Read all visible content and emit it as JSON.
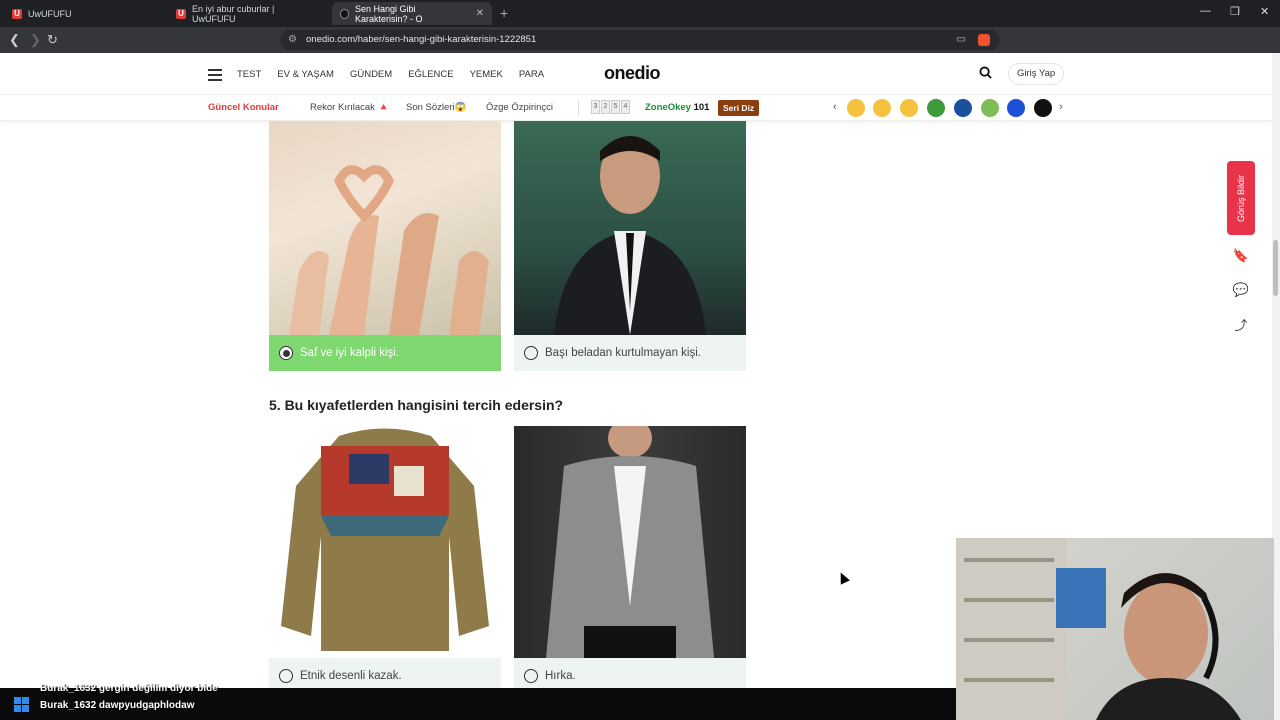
{
  "browser": {
    "tabs": [
      {
        "title": "UwUFUFU",
        "active": false
      },
      {
        "title": "En iyi abur cuburlar | UwUFUFU",
        "active": false
      },
      {
        "title": "Sen Hangi Gibi Karakterisin? - O",
        "active": true
      }
    ],
    "url": "onedio.com/haber/sen-hangi-gibi-karakterisin-1222851"
  },
  "site": {
    "logo": "onedio",
    "menu": [
      "TEST",
      "EV & YAŞAM",
      "GÜNDEM",
      "EĞLENCE",
      "YEMEK",
      "PARA"
    ],
    "login": "Giriş Yap",
    "topics_label": "Güncel Konular",
    "topics": [
      "Rekor Kırılacak 🔺",
      "Son Sözleri😱",
      "Özge Özpirinçci"
    ],
    "zone_numbers": [
      "3",
      "2",
      "5",
      "4"
    ],
    "zone_brand": "ZoneOkey",
    "zone_num": "101",
    "seri_diz": "Seri Diz",
    "reaction_colors": [
      "#f6c23e",
      "#f6c23e",
      "#f6c23e",
      "#3f9a3a",
      "#1b4fa0",
      "#7dbd55",
      "#1d4fd8",
      "#111111"
    ]
  },
  "quiz": {
    "prev_answers": [
      {
        "label": "Saf ve iyi kalpli kişi.",
        "selected": true
      },
      {
        "label": "Başı beladan kurtulmayan kişi.",
        "selected": false
      }
    ],
    "question5": "5. Bu kıyafetlerden hangisini tercih edersin?",
    "q5_answers": [
      {
        "label": "Etnik desenli kazak.",
        "selected": false
      },
      {
        "label": "Hırka.",
        "selected": false
      }
    ]
  },
  "sidebar": {
    "feedback": "Görüş Bildir"
  },
  "stream": {
    "chat": [
      "Burak_1632  gergin değilim diyor bide",
      "Burak_1632  dawpyudgaphlodaw"
    ]
  }
}
